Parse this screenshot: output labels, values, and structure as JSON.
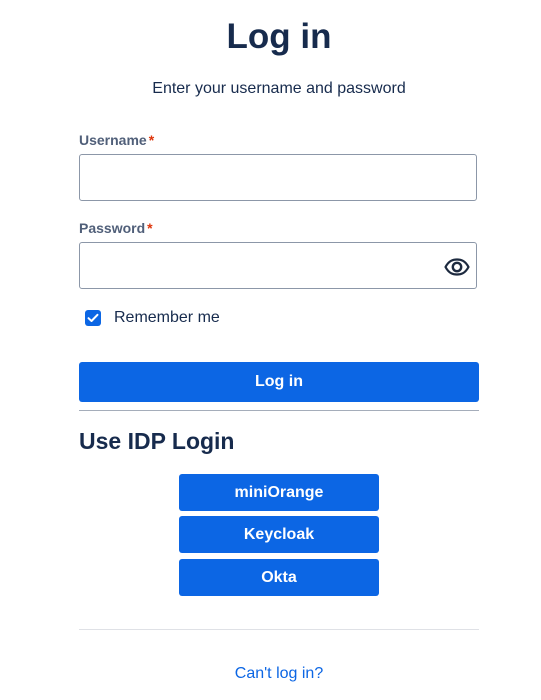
{
  "page": {
    "title": "Log in",
    "subtitle": "Enter your username and password"
  },
  "form": {
    "username": {
      "label": "Username",
      "required_mark": "*",
      "value": "",
      "placeholder": ""
    },
    "password": {
      "label": "Password",
      "required_mark": "*",
      "value": "",
      "placeholder": "",
      "toggle_icon": "eye-icon"
    },
    "remember": {
      "label": "Remember me",
      "checked": true
    },
    "submit_label": "Log in"
  },
  "idp": {
    "heading": "Use IDP Login",
    "providers": [
      {
        "label": "miniOrange"
      },
      {
        "label": "Keycloak"
      },
      {
        "label": "Okta"
      }
    ]
  },
  "footer": {
    "cant_login": "Can't log in?"
  },
  "colors": {
    "primary": "#0c66e4",
    "text": "#172b4d",
    "label": "#505f79",
    "required": "#de350b",
    "border": "#8c97a8"
  }
}
